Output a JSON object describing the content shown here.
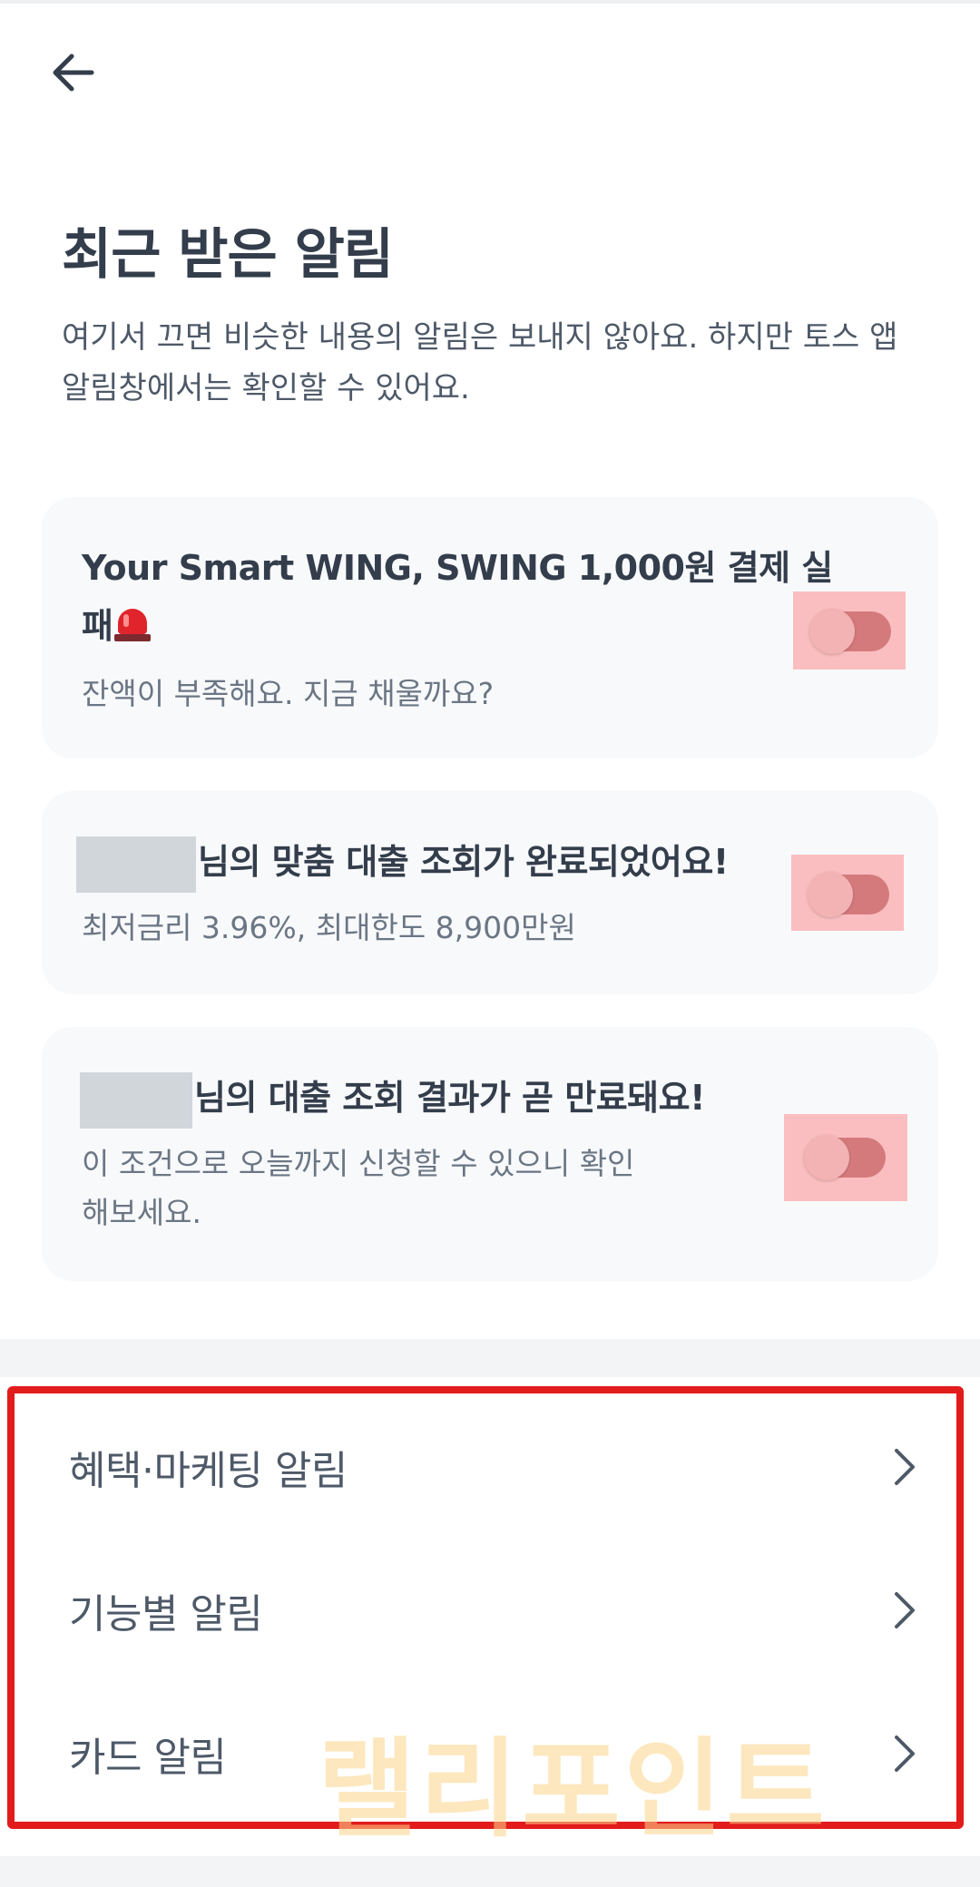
{
  "header": {
    "back_icon": "arrow-left-icon",
    "title": "최근 받은 알림",
    "description": "여기서 끄면 비슷한 내용의 알림은 보내지 않아요. 하지만 토스 앱 알림창에서는 확인할 수 있어요."
  },
  "notifications": [
    {
      "title": "Your Smart WING, SWING 1,000원 결제 실패",
      "title_icon": "siren-icon",
      "subtitle": "잔액이 부족해요. 지금 채울까요?",
      "enabled": false
    },
    {
      "title": "님의 맞춤 대출 조회가 완료되었어요!",
      "redacted_name": true,
      "subtitle": "최저금리 3.96%, 최대한도 8,900만원",
      "enabled": false
    },
    {
      "title": "님의 대출 조회 결과가 곧 만료돼요!",
      "redacted_name": true,
      "subtitle": "이 조건으로 오늘까지 신청할 수 있으니 확인해보세요.",
      "enabled": false
    }
  ],
  "menu": [
    {
      "label": "혜택·마케팅 알림",
      "icon": "chevron-right-icon"
    },
    {
      "label": "기능별 알림",
      "icon": "chevron-right-icon"
    },
    {
      "label": "카드 알림",
      "icon": "chevron-right-icon"
    }
  ],
  "watermark": "랠리포인트",
  "colors": {
    "text_primary": "#333d4b",
    "text_secondary": "#6b7684",
    "card_background": "#f8f9fb",
    "highlight_box": "#e21b1b",
    "toggle_highlight": "#fbbec0"
  }
}
